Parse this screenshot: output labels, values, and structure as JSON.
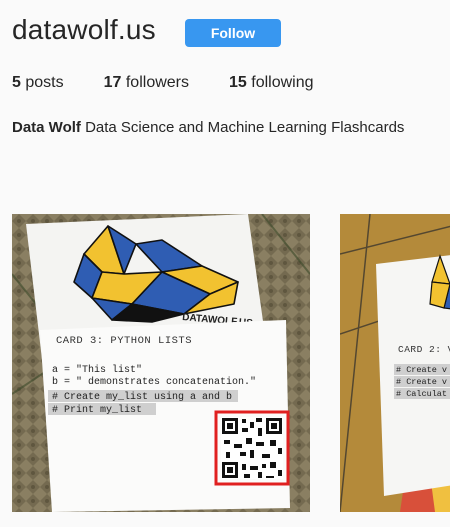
{
  "profile": {
    "username": "datawolf.us",
    "follow_label": "Follow",
    "stats": [
      {
        "count": "5",
        "label": "posts"
      },
      {
        "count": "17",
        "label": "followers"
      },
      {
        "count": "15",
        "label": "following"
      }
    ],
    "bio_name": "Data Wolf",
    "bio_text": "Data Science and Machine Learning Flashcards"
  },
  "posts": [
    {
      "logo_text": "DATAWOLF.US",
      "card_title": "CARD 3: PYTHON LISTS",
      "code_lines": [
        "a = \"This list\"",
        "b = \" demonstrates concatenation.\"",
        "# Create my_list using a and b",
        "# Print my_list"
      ]
    },
    {
      "card_title": "CARD 2: V",
      "code_lines": [
        "# Create v",
        "# Create v",
        "# Calculat"
      ]
    }
  ],
  "colors": {
    "follow_button": "#3897f0",
    "wolf_yellow": "#f2c230",
    "wolf_blue": "#2f5db3",
    "qr_highlight": "#e02020"
  }
}
